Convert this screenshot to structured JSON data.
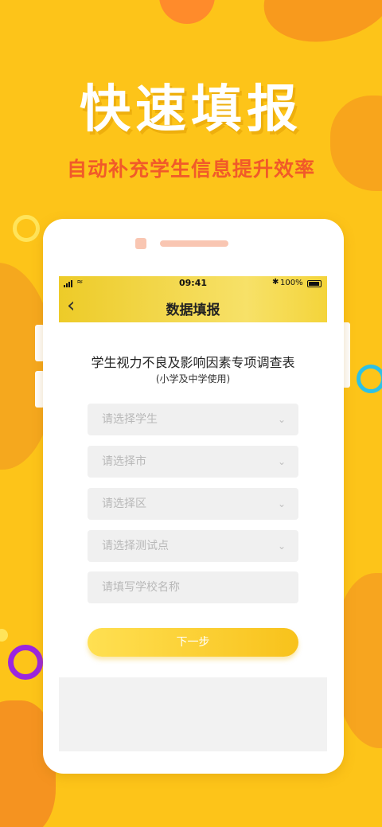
{
  "promo": {
    "headline": "快速填报",
    "subheadline": "自动补充学生信息提升效率"
  },
  "status_bar": {
    "time": "09:41",
    "battery": "100%"
  },
  "header": {
    "title": "数据填报",
    "back_icon": "chevron-left-icon"
  },
  "form": {
    "title": "学生视力不良及影响因素专项调查表",
    "subtitle": "(小学及中学使用)",
    "fields": [
      {
        "placeholder": "请选择学生",
        "type": "select"
      },
      {
        "placeholder": "请选择市",
        "type": "select"
      },
      {
        "placeholder": "请选择区",
        "type": "select"
      },
      {
        "placeholder": "请选择测试点",
        "type": "select"
      },
      {
        "placeholder": "请填写学校名称",
        "type": "text"
      }
    ],
    "next_label": "下一步"
  },
  "colors": {
    "background": "#FDC419",
    "headline": "#FFFFFF",
    "subheadline": "#F15A29",
    "accent_button": "#F8C21B"
  }
}
